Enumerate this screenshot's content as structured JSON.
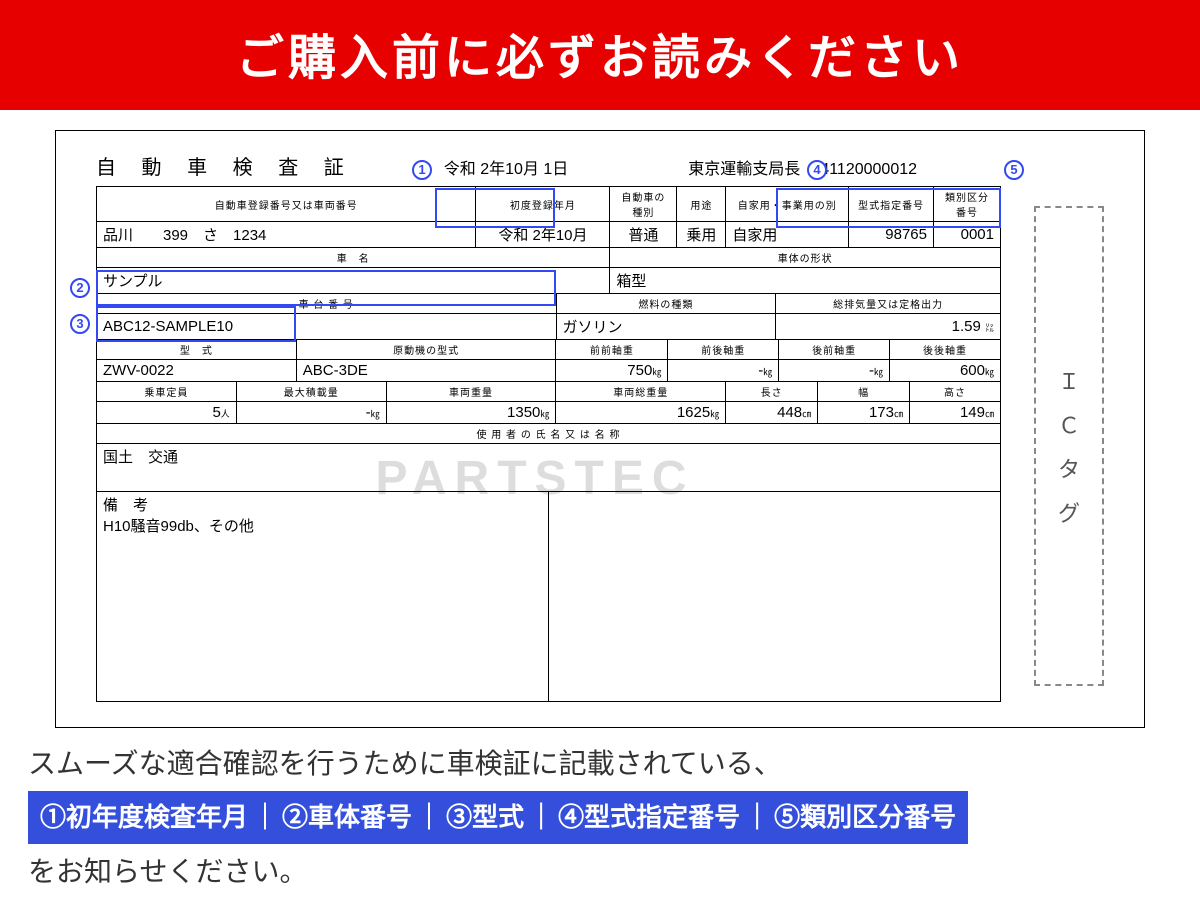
{
  "banner": "ご購入前に必ずお読みください",
  "doc": {
    "title": "自 動 車 検 査 証",
    "date": "令和 2年10月 1日",
    "issuer": "東京運輸支局長",
    "serial": "41120000012",
    "headers": {
      "reg": "自動車登録番号又は車両番号",
      "first_month": "初度登録年月",
      "car_kind": "自動車の種別",
      "use": "用途",
      "priv": "自家用・事業用の別",
      "type_num": "型式指定番号",
      "class_num": "類別区分番号",
      "car_name": "車　名",
      "body_shape": "車体の形状",
      "chassis": "車 台 番 号",
      "fuel": "燃料の種類",
      "disp": "総排気量又は定格出力",
      "model": "型　式",
      "engine": "原動機の型式",
      "ff": "前前軸重",
      "fr": "前後軸重",
      "rf": "後前軸重",
      "rr": "後後軸重",
      "cap": "乗車定員",
      "max": "最大積載量",
      "vw": "車両重量",
      "gvw": "車両総重量",
      "len": "長さ",
      "wid": "幅",
      "hei": "高さ",
      "user": "使 用 者 の 氏 名 又 は 名 称",
      "note": "備　考"
    },
    "values": {
      "reg": "品川　　399　さ　1234",
      "first_month": "令和 2年10月",
      "car_kind": "普通",
      "use": "乗用",
      "priv": "自家用",
      "type_num": "98765",
      "class_num": "0001",
      "car_name": "サンプル",
      "body_shape": "箱型",
      "chassis": "ABC12-SAMPLE10",
      "fuel": "ガソリン",
      "disp": "1.59",
      "disp_u": "㍑",
      "model": "ZWV-0022",
      "engine": "ABC-3DE",
      "ff": "750",
      "fr": "-",
      "rf": "-",
      "rr": "600",
      "cap": "5",
      "cap_u": "人",
      "max": "-",
      "vw": "1350",
      "gvw": "1625",
      "kg": "㎏",
      "len": "448",
      "wid": "173",
      "hei": "149",
      "cm": "㎝",
      "user": "国土　交通",
      "note": "H10騒音99db、その他"
    },
    "ictag": [
      "Ｉ",
      "Ｃ",
      "タ",
      "グ"
    ]
  },
  "markers": {
    "m1": "1",
    "m2": "2",
    "m3": "3",
    "m4": "4",
    "m5": "5"
  },
  "watermark": "PARTSTEC",
  "footer": {
    "line1": "スムーズな適合確認を行うために車検証に記載されている、",
    "band": {
      "i1": "①初年度検査年月",
      "i2": "②車体番号",
      "i3": "③型式",
      "i4": "④型式指定番号",
      "i5": "⑤類別区分番号",
      "sep": "｜"
    },
    "line3": "をお知らせください。"
  }
}
